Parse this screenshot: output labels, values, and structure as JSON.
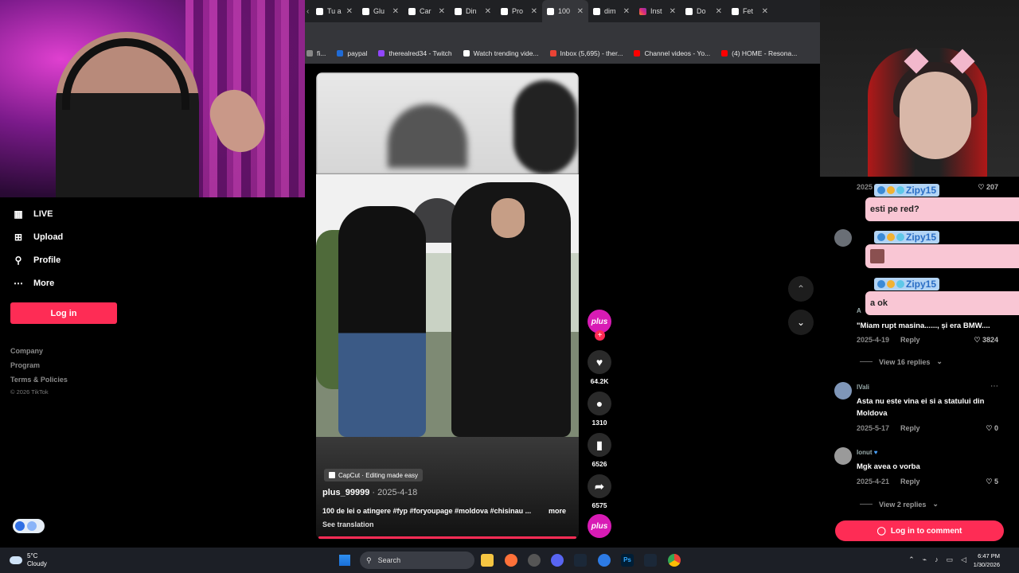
{
  "browser": {
    "tabs": [
      {
        "label": "Tu a",
        "icon": "tiktok-icon"
      },
      {
        "label": "Glu",
        "icon": "tiktok-icon"
      },
      {
        "label": "Car",
        "icon": "tiktok-icon"
      },
      {
        "label": "Din",
        "icon": "tiktok-icon"
      },
      {
        "label": "Pro",
        "icon": "tiktok-icon"
      },
      {
        "label": "100",
        "icon": "tiktok-icon",
        "active": true
      },
      {
        "label": "dim",
        "icon": "tiktok-icon"
      },
      {
        "label": "Inst",
        "icon": "instagram-icon"
      },
      {
        "label": "Do",
        "icon": "tiktok-icon"
      },
      {
        "label": "Fet",
        "icon": "tiktok-icon"
      }
    ],
    "bookmarks": [
      {
        "label": "fi...",
        "color": "#888888"
      },
      {
        "label": "paypal",
        "color": "#1f6bd6"
      },
      {
        "label": "therealred34 - Twitch",
        "color": "#9146ff"
      },
      {
        "label": "Watch trending vide...",
        "color": "#ffffff"
      },
      {
        "label": "Inbox (5,695) - ther...",
        "color": "#ea4335"
      },
      {
        "label": "Channel videos - Yo...",
        "color": "#ff0000"
      },
      {
        "label": "(4) HOME - Resona...",
        "color": "#ff0000"
      }
    ]
  },
  "sidebar": {
    "nav": [
      {
        "label": "LIVE",
        "icon": "live-icon"
      },
      {
        "label": "Upload",
        "icon": "upload-icon"
      },
      {
        "label": "Profile",
        "icon": "profile-icon"
      },
      {
        "label": "More",
        "icon": "more-icon"
      }
    ],
    "login_label": "Log in",
    "footer_links": [
      "Company",
      "Program",
      "Terms & Policies"
    ],
    "copyright": "© 2026 TikTok"
  },
  "video": {
    "capcut_label": "CapCut · Editing made easy",
    "author": "plus_99999",
    "date": " · 2025-4-18",
    "caption": "100 de lei o atingere  #fyp  #foryoupage #moldova #chisinau ...",
    "more_label": "more",
    "see_translation": "See translation",
    "progress": 1.0
  },
  "actions": {
    "avatar_label": "plus",
    "likes": "64.2K",
    "comments": "1310",
    "saves": "6526",
    "shares": "6575"
  },
  "comments": {
    "items": [
      {
        "date": "2025",
        "likes": "207"
      },
      {
        "name": "A",
        "text": "\"Miam rupt masina......, și era BMW....",
        "date": "2025-4-19",
        "reply": "Reply",
        "likes": "3824",
        "view_replies": "View 16 replies"
      },
      {
        "name": "lVali",
        "text": "Asta nu este vina ei si a statului din Moldova",
        "date": "2025-5-17",
        "reply": "Reply",
        "likes": "0"
      },
      {
        "name": "Ionut",
        "text": "Mgk avea o vorba",
        "date": "2025-4-21",
        "reply": "Reply",
        "likes": "5",
        "view_replies": "View 2 replies"
      }
    ],
    "login_label": "Log in to comment"
  },
  "chat": [
    {
      "user": "Zipy15",
      "message": "esti pe red?"
    },
    {
      "user": "Zipy15",
      "message": ""
    },
    {
      "user": "Zipy15",
      "message": "a ok"
    }
  ],
  "taskbar": {
    "temp": "5°C",
    "weather": "Cloudy",
    "search": "Search",
    "time": "6:47 PM",
    "date": "1/30/2026"
  },
  "colors": {
    "accent": "#fe2c55",
    "chat_bubble": "#f9c6d4",
    "chat_name": "#b2d4f5"
  }
}
